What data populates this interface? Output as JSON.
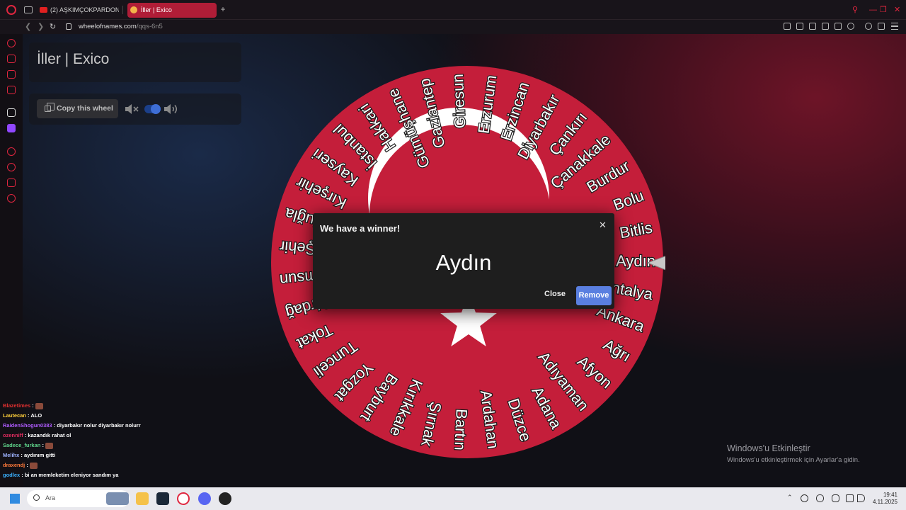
{
  "browser": {
    "tabs": [
      {
        "label": "(2) AŞKIMÇOKPARDON |"
      },
      {
        "label": "İller | Exico"
      }
    ],
    "url": {
      "domain": "wheelofnames.com",
      "path": "/qqs-6n5"
    }
  },
  "page": {
    "wheel_title": "İller | Exico",
    "copy_button_label": "Copy this wheel",
    "sound_enabled": true
  },
  "wheel": {
    "primary_color": "#c41e3a",
    "accent_color": "#ffffff",
    "pointer_color": "#c8c8c8",
    "visible_labels": [
      "Giresun",
      "Erzurum",
      "Erzincan",
      "Diyarbakır",
      "Çankırı",
      "Çanakkale",
      "Burdur",
      "Bolu",
      "Bitlis",
      "Aydın",
      "Antalya",
      "Ankara",
      "Ağrı",
      "Afyon",
      "Adıyaman",
      "Adana",
      "Düzce",
      "Ardahan",
      "Bartın",
      "Şırnak",
      "Kırıkkale",
      "Bayburt",
      "Yozgat",
      "Tunceli",
      "Tokat",
      "Tekirdağ",
      "Samsun",
      "Şehir",
      "Muğla",
      "Kırşehir",
      "Kayseri",
      "İstanbul",
      "Hakkari",
      "Gümüşhane",
      "Gaziantep"
    ]
  },
  "modal": {
    "title": "We have a winner!",
    "winner": "Aydın",
    "close_label": "Close",
    "remove_label": "Remove"
  },
  "chat": {
    "messages": [
      {
        "user": "Blazetimes",
        "text": "",
        "color": "#e03030",
        "emote": true
      },
      {
        "user": "Lautecan",
        "text": "ALO",
        "color": "#ffcf3a",
        "emote": false
      },
      {
        "user": "RaidenShogun0383",
        "text": "diyarbakır nolur diyarbakır nolurr",
        "color": "#b05cff",
        "emote": false
      },
      {
        "user": "ozenniff",
        "text": "kazandık rahat ol",
        "color": "#e02c5f",
        "emote": false
      },
      {
        "user": "Sadece_furkan",
        "text": "",
        "color": "#5fd38a",
        "emote": true
      },
      {
        "user": "Melihx",
        "text": "aydınım gitti",
        "color": "#9fb3ff",
        "emote": false
      },
      {
        "user": "draxendj",
        "text": "",
        "color": "#ff7a3a",
        "emote": true
      },
      {
        "user": "godlex",
        "text": "bi an memleketim eleniyor sandım ya",
        "color": "#3ab0ff",
        "emote": false
      }
    ]
  },
  "windows_activation": {
    "title": "Windows'u Etkinleştir",
    "subtitle": "Windows'u etkinleştirmek için Ayarlar'a gidin."
  },
  "taskbar": {
    "search_label": "Ara",
    "time": "19:41",
    "date": "4.11.2025"
  }
}
